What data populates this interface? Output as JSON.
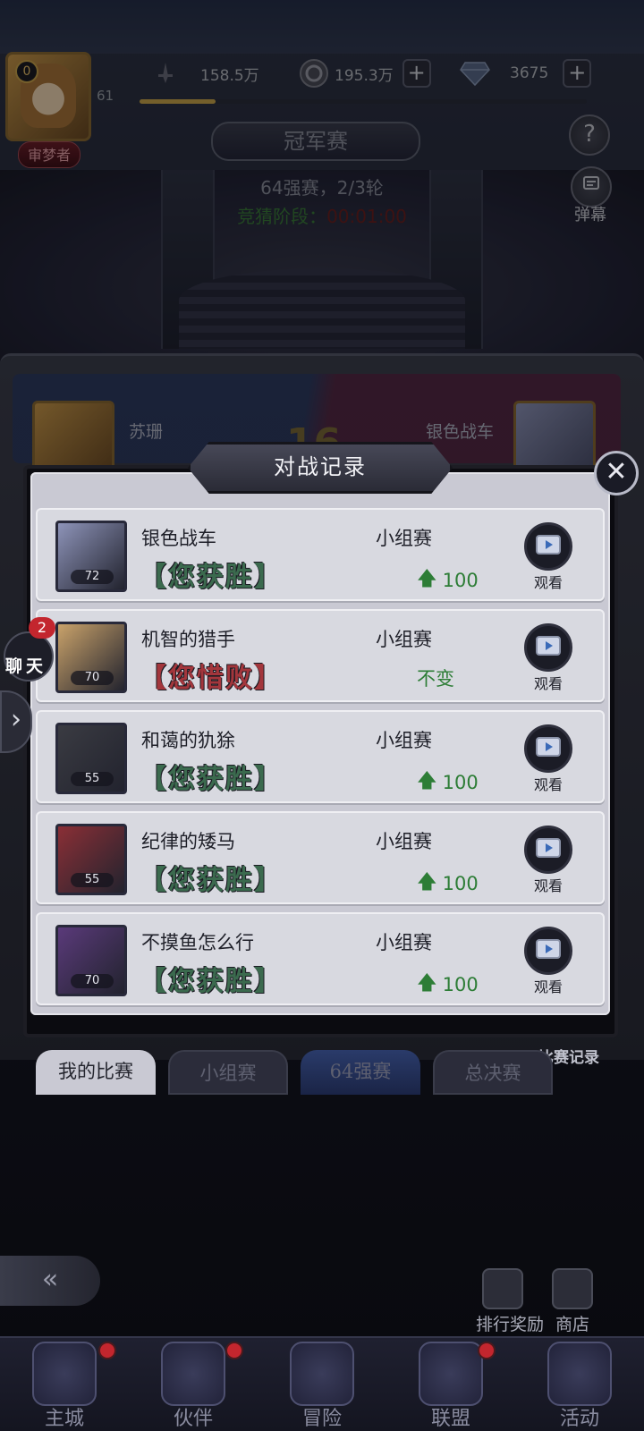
{
  "header": {
    "player_avatar_level": "0",
    "player_level": "61",
    "player_title": "审梦者",
    "resources": {
      "power": "158.5万",
      "gold": "195.3万",
      "diamond": "3675"
    },
    "exp_progress": 0.17
  },
  "side_buttons": {
    "help_icon": "?",
    "danmaku_label": "弹幕"
  },
  "event": {
    "title": "冠军赛",
    "round_info": "64强赛，2/3轮",
    "phase_label": "竞猜阶段：",
    "phase_time": "00:01:00",
    "left_player": "苏珊",
    "right_player": "银色战车",
    "vs_number": "16"
  },
  "modal": {
    "title": "对战记录",
    "close_icon": "✕",
    "watch_label": "观看",
    "records": [
      {
        "opponent": "银色战车",
        "level": "72",
        "result": "【您获胜】",
        "result_type": "win",
        "stage": "小组赛",
        "change": "100",
        "change_up": true,
        "portrait_color": "#8d93b8"
      },
      {
        "opponent": "机智的猎手",
        "level": "70",
        "result": "【您惜败】",
        "result_type": "lose",
        "stage": "小组赛",
        "change": "不变",
        "change_up": false,
        "portrait_color": "#c9a26a"
      },
      {
        "opponent": "和蔼的犰狳",
        "level": "55",
        "result": "【您获胜】",
        "result_type": "win",
        "stage": "小组赛",
        "change": "100",
        "change_up": true,
        "portrait_color": "#3a3b42"
      },
      {
        "opponent": "纪律的矮马",
        "level": "55",
        "result": "【您获胜】",
        "result_type": "win",
        "stage": "小组赛",
        "change": "100",
        "change_up": true,
        "portrait_color": "#8a2f36"
      },
      {
        "opponent": "不摸鱼怎么行",
        "level": "70",
        "result": "【您获胜】",
        "result_type": "win",
        "stage": "小组赛",
        "change": "100",
        "change_up": true,
        "portrait_color": "#5a3a7a"
      }
    ]
  },
  "chat": {
    "badge_count": "2",
    "label": "聊天"
  },
  "match_record_link": "比赛记录",
  "tabs": [
    "我的比赛",
    "小组赛",
    "64强赛",
    "总决赛"
  ],
  "bottom_actions": {
    "rank_reward": "排行奖励",
    "shop": "商店"
  },
  "nav": [
    "主城",
    "伙伴",
    "冒险",
    "联盟",
    "活动"
  ],
  "colors": {
    "win_green": "#3b6a4e",
    "lose_red": "#a3363c",
    "up_arrow_green": "#2d7d36",
    "badge_red": "#c3262e"
  }
}
